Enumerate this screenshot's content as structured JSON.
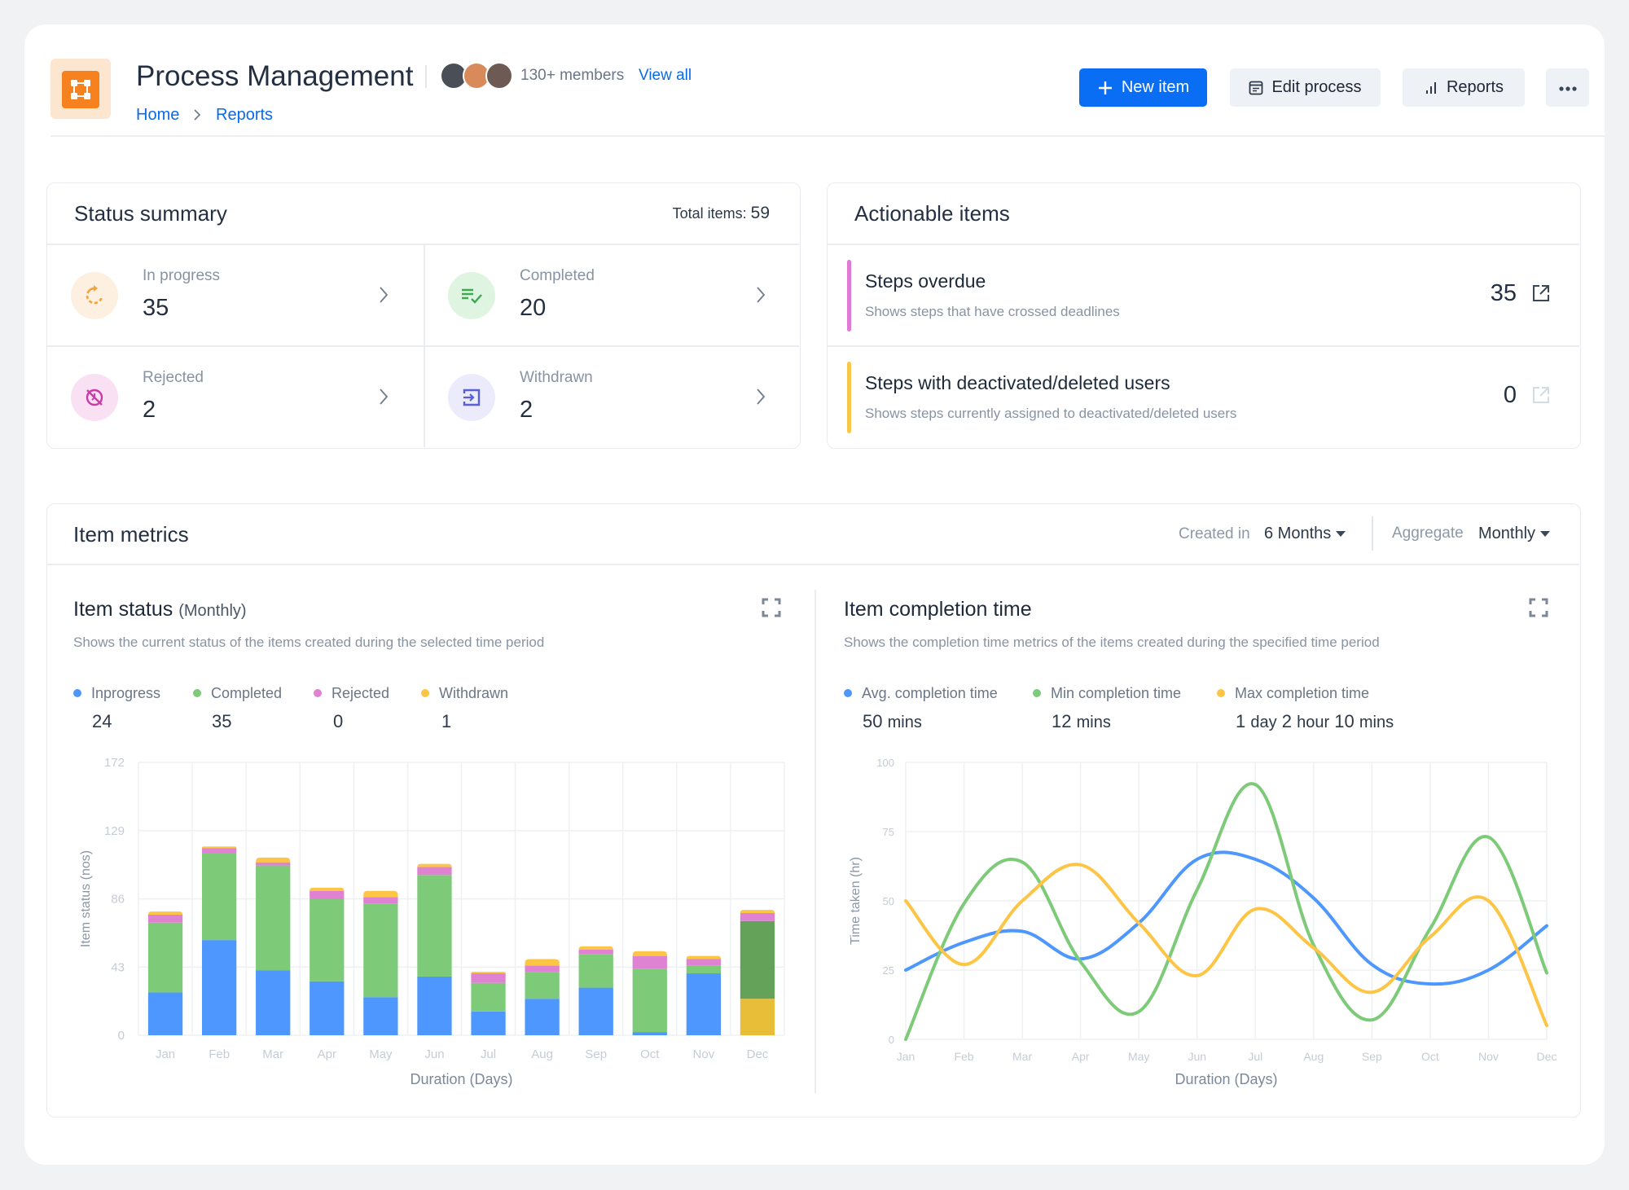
{
  "header": {
    "title": "Process Management",
    "members_text": "130+ members",
    "view_all": "View all",
    "breadcrumb": [
      {
        "label": "Home"
      },
      {
        "label": "Reports"
      }
    ],
    "avatars": [
      {
        "name": "member-1",
        "color": "#4a4f57"
      },
      {
        "name": "member-2",
        "color": "#d98a5a"
      },
      {
        "name": "member-3",
        "color": "#6d5a55"
      }
    ],
    "buttons": {
      "new_item": "New item",
      "edit_process": "Edit process",
      "reports": "Reports",
      "more": "more-options"
    }
  },
  "status_summary": {
    "title": "Status summary",
    "total_label": "Total items:",
    "total_value": "59",
    "items": [
      {
        "label": "In progress",
        "value": "35",
        "icon": "refresh-icon",
        "color": "#f7a13b",
        "bg": "#fdf0e1"
      },
      {
        "label": "Completed",
        "value": "20",
        "icon": "list-check-icon",
        "color": "#3daa4f",
        "bg": "#dff5e2"
      },
      {
        "label": "Rejected",
        "value": "2",
        "icon": "rejected-circle-icon",
        "color": "#cc3aa8",
        "bg": "#fae0f3"
      },
      {
        "label": "Withdrawn",
        "value": "2",
        "icon": "withdraw-icon",
        "color": "#5b5fd6",
        "bg": "#ebebfb"
      }
    ]
  },
  "actionable_items": {
    "title": "Actionable items",
    "items": [
      {
        "title": "Steps overdue",
        "description": "Shows steps that have crossed deadlines",
        "count": "35",
        "accent": "#e07ad5",
        "link_enabled": true
      },
      {
        "title": "Steps with deactivated/deleted users",
        "description": "Shows steps currently assigned to deactivated/deleted users",
        "count": "0",
        "accent": "#fac748",
        "link_enabled": false
      }
    ]
  },
  "item_metrics": {
    "title": "Item metrics",
    "filters": {
      "created_in_label": "Created in",
      "created_in_value": "6 Months",
      "aggregate_label": "Aggregate",
      "aggregate_value": "Monthly"
    }
  },
  "item_status": {
    "title": "Item status",
    "title_suffix": "(Monthly)",
    "subtitle": "Shows the current status of the items created during the selected time period",
    "legend": [
      {
        "label": "Inprogress",
        "value": "24",
        "color": "#4d97fe"
      },
      {
        "label": "Completed",
        "value": "35",
        "color": "#7dcb79"
      },
      {
        "label": "Rejected",
        "value": "0",
        "color": "#e082d2"
      },
      {
        "label": "Withdrawn",
        "value": "1",
        "color": "#fcc545"
      }
    ]
  },
  "completion_time": {
    "title": "Item completion time",
    "subtitle": "Shows the completion time metrics of the items created during the specified time period",
    "legend": [
      {
        "label": "Avg. completion time",
        "color": "#4d97fe",
        "value_parts": [
          {
            "n": "50",
            "u": "mins"
          }
        ]
      },
      {
        "label": "Min completion time",
        "color": "#7dcb79",
        "value_parts": [
          {
            "n": "12",
            "u": "mins"
          }
        ]
      },
      {
        "label": "Max completion time",
        "color": "#fcc545",
        "value_parts": [
          {
            "n": "1",
            "u": "day"
          },
          {
            "n": "2",
            "u": "hour"
          },
          {
            "n": "10",
            "u": "mins"
          }
        ]
      }
    ]
  },
  "chart_data": [
    {
      "type": "bar",
      "stacked": true,
      "title": "Item status (Monthly)",
      "xlabel": "Duration (Days)",
      "ylabel": "Item status (nos)",
      "categories": [
        "Jan",
        "Feb",
        "Mar",
        "Apr",
        "May",
        "Jun",
        "Jul",
        "Aug",
        "Sep",
        "Oct",
        "Nov",
        "Dec"
      ],
      "yticks": [
        0,
        43,
        86,
        129,
        172
      ],
      "ylim": [
        0,
        172
      ],
      "grid": true,
      "highlighted_category": "Dec",
      "series": [
        {
          "name": "Inprogress",
          "color": "#4d97fe",
          "highlight_color": "#e8bd38",
          "values": [
            27,
            60,
            41,
            34,
            24,
            37,
            15,
            23,
            30,
            2,
            39,
            23
          ]
        },
        {
          "name": "Completed",
          "color": "#7dcb79",
          "highlight_color": "#64a259",
          "values": [
            44,
            55,
            66,
            52,
            59,
            64,
            18,
            17,
            21,
            40,
            5,
            49
          ]
        },
        {
          "name": "Rejected",
          "color": "#e082d2",
          "highlight_color": "#e082d2",
          "values": [
            5,
            3,
            2,
            5,
            4,
            5,
            6,
            4,
            3,
            8,
            4,
            5
          ]
        },
        {
          "name": "Withdrawn",
          "color": "#fcc545",
          "highlight_color": "#fcc545",
          "values": [
            2,
            1,
            3,
            2,
            4,
            2,
            1,
            4,
            2,
            3,
            2,
            2
          ]
        }
      ]
    },
    {
      "type": "line",
      "smooth": true,
      "title": "Item completion time",
      "xlabel": "Duration (Days)",
      "ylabel": "Time taken (hr)",
      "categories": [
        "Jan",
        "Feb",
        "Mar",
        "Apr",
        "May",
        "Jun",
        "Jul",
        "Aug",
        "Sep",
        "Oct",
        "Nov",
        "Dec"
      ],
      "yticks": [
        0,
        25,
        50,
        75,
        100
      ],
      "ylim": [
        0,
        100
      ],
      "grid": true,
      "series": [
        {
          "name": "Avg. completion time",
          "color": "#4d97fe",
          "values": [
            25,
            35,
            39,
            29,
            42,
            65,
            65,
            51,
            27,
            20,
            25,
            41
          ]
        },
        {
          "name": "Min completion time",
          "color": "#7dcb79",
          "values": [
            0,
            49,
            64,
            28,
            10,
            54,
            92,
            34,
            7,
            40,
            73,
            24
          ]
        },
        {
          "name": "Max completion time",
          "color": "#fcc545",
          "values": [
            50,
            27,
            50,
            63,
            42,
            23,
            47,
            33,
            17,
            37,
            50,
            5
          ]
        }
      ]
    }
  ]
}
